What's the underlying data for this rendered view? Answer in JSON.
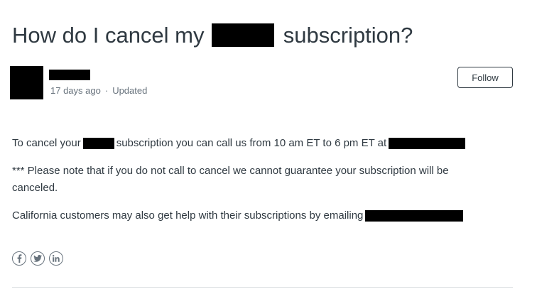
{
  "article": {
    "title_before": "How do I cancel my",
    "title_after": "subscription?",
    "meta": {
      "age": "17 days ago",
      "separator": "·",
      "updated": "Updated"
    },
    "follow_label": "Follow",
    "paragraph1": {
      "before": "To cancel your",
      "middle": "subscription you can call us from 10 am ET to 6 pm ET at"
    },
    "paragraph2": "*** Please note that if you do not call to cancel we cannot guarantee your subscription will be canceled.",
    "paragraph3": "California customers may also get help with their subscriptions by emailing"
  },
  "share": {
    "icons": [
      "facebook-icon",
      "twitter-icon",
      "linkedin-icon"
    ]
  },
  "colors": {
    "text": "#2f3941",
    "muted": "#68737d",
    "divider": "#d8dcde"
  }
}
